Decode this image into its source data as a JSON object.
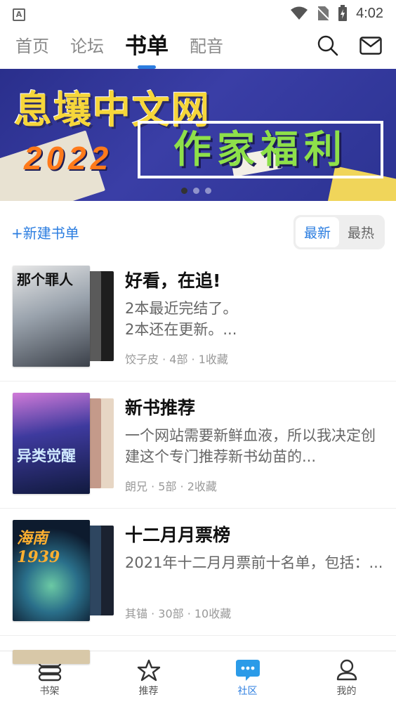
{
  "status": {
    "time": "4:02"
  },
  "top_tabs": [
    {
      "label": "首页"
    },
    {
      "label": "论坛"
    },
    {
      "label": "书单",
      "active": true
    },
    {
      "label": "配音"
    }
  ],
  "icons": {
    "search": "search-icon",
    "mail": "mail-icon"
  },
  "banner": {
    "title": "息壤中文网",
    "year": "2022",
    "subtitle": "作家福利",
    "dot_count": 3,
    "active_dot": 0
  },
  "list_header": {
    "new_label": "+新建书单",
    "sort": [
      {
        "label": "最新",
        "active": true
      },
      {
        "label": "最热"
      }
    ]
  },
  "book_lists": [
    {
      "title": "好看，在追!",
      "desc": "2本最近完结了。\n2本还在更新。...",
      "meta": "饺子皮 · 4部 · 1收藏",
      "cover_text": "那个罪人"
    },
    {
      "title": "新书推荐",
      "desc": "一个网站需要新鲜血液，所以我决定创建这个专门推荐新书幼苗的...",
      "meta": "朗兄 · 5部 · 2收藏",
      "cover_text": "异类觉醒"
    },
    {
      "title": "十二月月票榜",
      "desc": "2021年十二月月票前十名单，包括：...",
      "meta": "其锚 · 30部 · 10收藏",
      "cover_text": "海南1939"
    }
  ],
  "bottom_nav": [
    {
      "label": "书架",
      "icon": "bookshelf-icon"
    },
    {
      "label": "推荐",
      "icon": "star-icon"
    },
    {
      "label": "社区",
      "icon": "chat-bubble-icon",
      "active": true
    },
    {
      "label": "我的",
      "icon": "person-icon"
    }
  ],
  "colors": {
    "accent": "#2b7de0",
    "banner_bg": "#2a2f8c"
  }
}
